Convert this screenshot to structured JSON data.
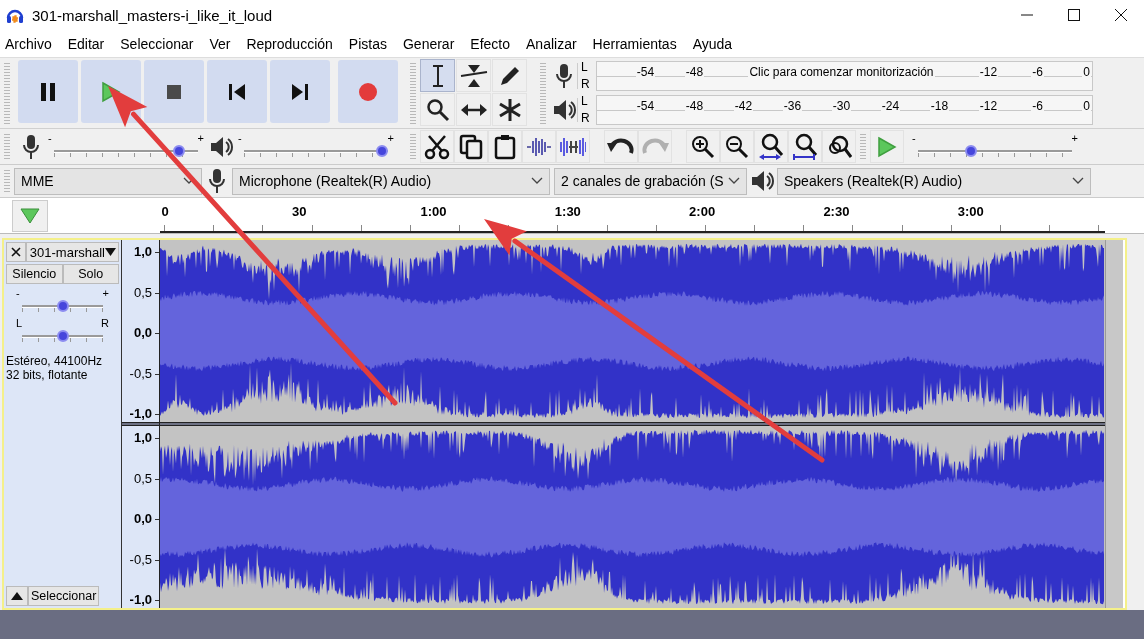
{
  "window": {
    "title": "301-marshall_masters-i_like_it_loud"
  },
  "menu": [
    "Archivo",
    "Editar",
    "Seleccionar",
    "Ver",
    "Reproducción",
    "Pistas",
    "Generar",
    "Efecto",
    "Analizar",
    "Herramientas",
    "Ayuda"
  ],
  "transport": [
    {
      "kind": "pause"
    },
    {
      "kind": "play"
    },
    {
      "kind": "stop"
    },
    {
      "kind": "skip_start"
    },
    {
      "kind": "skip_end"
    },
    {
      "kind": "record"
    }
  ],
  "tools": [
    {
      "kind": "select",
      "selected": true
    },
    {
      "kind": "envelope",
      "selected": false
    },
    {
      "kind": "draw",
      "selected": false
    },
    {
      "kind": "zoom",
      "selected": false
    },
    {
      "kind": "timeshift",
      "selected": false
    },
    {
      "kind": "multi",
      "selected": false
    }
  ],
  "recording_meter": {
    "channels": [
      "L",
      "R"
    ],
    "scale": [
      {
        "kind": "tick",
        "label": "-54"
      },
      {
        "kind": "tick",
        "label": "-48"
      },
      {
        "kind": "message",
        "label": "Clic para comenzar monitorización"
      },
      {
        "kind": "tick",
        "label": "-12"
      },
      {
        "kind": "tick",
        "label": "-6"
      },
      {
        "kind": "tick",
        "label": "0"
      }
    ]
  },
  "playback_meter": {
    "channels": [
      "L",
      "R"
    ],
    "scale": [
      {
        "kind": "tick",
        "label": "-54"
      },
      {
        "kind": "tick",
        "label": "-48"
      },
      {
        "kind": "tick",
        "label": "-42"
      },
      {
        "kind": "tick",
        "label": "-36"
      },
      {
        "kind": "tick",
        "label": "-30"
      },
      {
        "kind": "tick",
        "label": "-24"
      },
      {
        "kind": "tick",
        "label": "-18"
      },
      {
        "kind": "tick",
        "label": "-12"
      },
      {
        "kind": "tick",
        "label": "-6"
      },
      {
        "kind": "tick",
        "label": "0"
      }
    ]
  },
  "recording_volume": {
    "min_label": "-",
    "max_label": "+",
    "level": 0.9
  },
  "playback_volume": {
    "min_label": "-",
    "max_label": "+",
    "level": 1.0
  },
  "edit_tools": [
    {
      "kind": "cut"
    },
    {
      "kind": "copy"
    },
    {
      "kind": "paste"
    },
    {
      "kind": "trim"
    },
    {
      "kind": "silence"
    }
  ],
  "history": [
    {
      "kind": "undo",
      "disabled": false
    },
    {
      "kind": "redo",
      "disabled": true
    }
  ],
  "zoom_tools": [
    {
      "kind": "zoom_in"
    },
    {
      "kind": "zoom_out"
    },
    {
      "kind": "fit_selection"
    },
    {
      "kind": "fit_project"
    },
    {
      "kind": "zoom_toggle"
    }
  ],
  "play_at_speed": {
    "min_label": "-",
    "max_label": "+",
    "level": 0.33
  },
  "devices": {
    "host": "MME",
    "recording_device": "Microphone (Realtek(R) Audio)",
    "channels": "2 canales de grabación (S",
    "playback_device": "Speakers (Realtek(R) Audio)"
  },
  "timeline": {
    "labels": [
      "0",
      "30",
      "1:00",
      "1:30",
      "2:00",
      "2:30",
      "3:00"
    ]
  },
  "track": {
    "name": "301-marshall",
    "buttons": [
      "Silencio",
      "Solo"
    ],
    "gain": {
      "min_label": "-",
      "max_label": "+",
      "level": 0.5
    },
    "pan": {
      "min_label": "L",
      "max_label": "R",
      "level": 0.5
    },
    "info": [
      "Estéreo, 44100Hz",
      "32 bits, flotante"
    ],
    "select_button": "Seleccionar",
    "channels": [
      {
        "ruler": [
          {
            "label": "1,0",
            "major": true
          },
          {
            "label": "0,5",
            "major": false
          },
          {
            "label": "0,0",
            "major": true
          },
          {
            "label": "-0,5",
            "major": false
          },
          {
            "label": "-1,0",
            "major": true
          }
        ]
      },
      {
        "ruler": [
          {
            "label": "1,0",
            "major": true
          },
          {
            "label": "0,5",
            "major": false
          },
          {
            "label": "0,0",
            "major": true
          },
          {
            "label": "-0,5",
            "major": false
          },
          {
            "label": "-1,0",
            "major": true
          }
        ]
      }
    ]
  },
  "annotation_arrows": [
    {
      "kind": "arrow"
    },
    {
      "kind": "arrow"
    }
  ]
}
